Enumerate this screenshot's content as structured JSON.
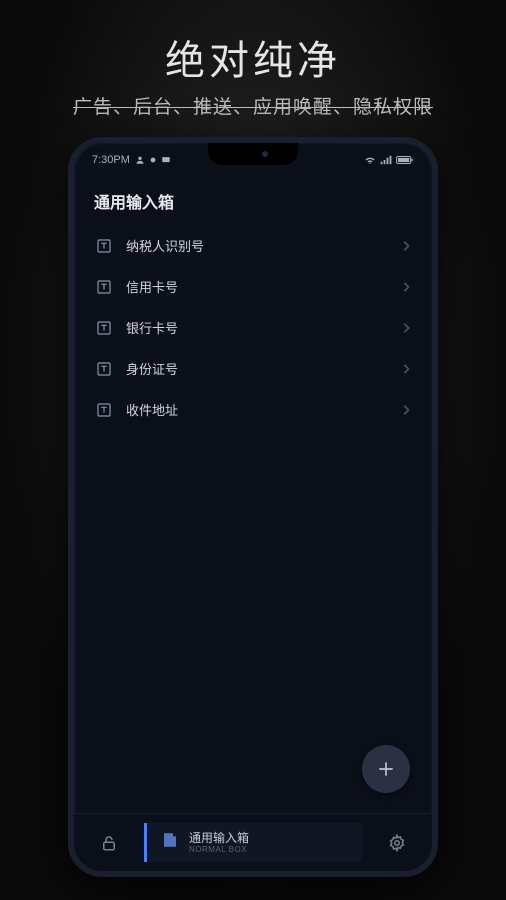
{
  "promo": {
    "title": "绝对纯净",
    "subtitle": "广告、后台、推送、应用唤醒、隐私权限"
  },
  "statusBar": {
    "time": "7:30PM"
  },
  "page": {
    "title": "通用输入箱"
  },
  "items": [
    {
      "label": "纳税人识别号"
    },
    {
      "label": "信用卡号"
    },
    {
      "label": "银行卡号"
    },
    {
      "label": "身份证号"
    },
    {
      "label": "收件地址"
    }
  ],
  "bottomNav": {
    "centerTitle": "通用输入箱",
    "centerSub": "NORMAL BOX"
  }
}
